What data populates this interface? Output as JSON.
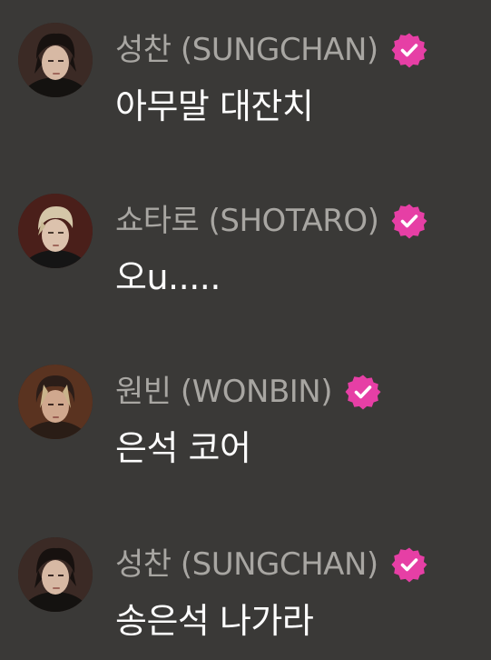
{
  "chat": {
    "messages": [
      {
        "sender": "성찬 (SUNGCHAN)",
        "text": "아무말 대잔치",
        "verified": true,
        "avatar_icon": "profile-photo",
        "avatar_bg": "#3b2a25"
      },
      {
        "sender": "쇼타로 (SHOTARO)",
        "text": "오u.....",
        "verified": true,
        "avatar_icon": "profile-photo",
        "avatar_bg": "#4a1f1a"
      },
      {
        "sender": "원빈 (WONBIN)",
        "text": "은석 코어",
        "verified": true,
        "avatar_icon": "profile-photo",
        "avatar_bg": "#5a3320"
      },
      {
        "sender": "성찬 (SUNGCHAN)",
        "text": "송은석 나가라",
        "verified": true,
        "avatar_icon": "profile-photo",
        "avatar_bg": "#3b2a25"
      }
    ]
  },
  "colors": {
    "background": "#3a3937",
    "sender": "#a8a6a2",
    "message": "#ffffff",
    "verified_badge": "#e63fa5"
  }
}
